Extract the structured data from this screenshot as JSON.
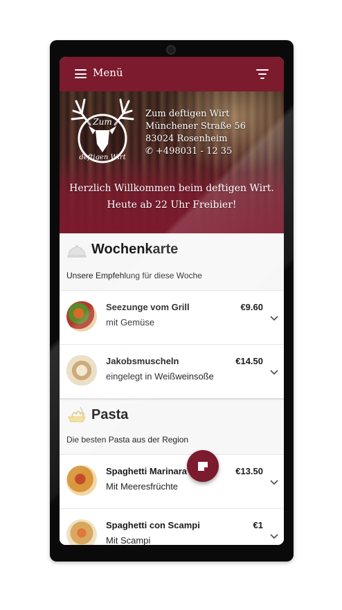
{
  "topbar": {
    "menu_label": "Menü",
    "menu_icon": "hamburger-icon",
    "filter_icon": "filter-icon"
  },
  "restaurant": {
    "logo_text_top": "Zum",
    "logo_text_bottom": "deftigen Wirt",
    "name": "Zum deftigen Wirt",
    "street": "Münchener Straße 56",
    "city": "83024 Rosenheim",
    "phone": "+498031 - 12 35"
  },
  "welcome": {
    "line1": "Herzlich Willkommen beim deftigen Wirt.",
    "line2": "Heute ab 22 Uhr Freibier!"
  },
  "sections": [
    {
      "title": "Wochenkarte",
      "subtitle": "Unsere Empfehlung für diese Woche",
      "icon": "cloche-icon",
      "items": [
        {
          "name": "Seezunge vom Grill",
          "desc": "mit Gemüse",
          "price": "€9.60"
        },
        {
          "name": "Jakobsmuscheln",
          "desc": "eingelegt in Weißweinsoße",
          "price": "€14.50"
        }
      ]
    },
    {
      "title": "Pasta",
      "subtitle": "Die besten Pasta aus der Region",
      "icon": "pasta-icon",
      "items": [
        {
          "name": "Spaghetti Marinara",
          "desc": "Mit Meeresfrüchte",
          "price": "€13.50"
        },
        {
          "name": "Spaghetti con Scampi",
          "desc": "Mit Scampi",
          "price": "€1"
        }
      ]
    }
  ],
  "fab": {
    "icon": "note-icon"
  },
  "colors": {
    "brand": "#7c1a2e"
  }
}
